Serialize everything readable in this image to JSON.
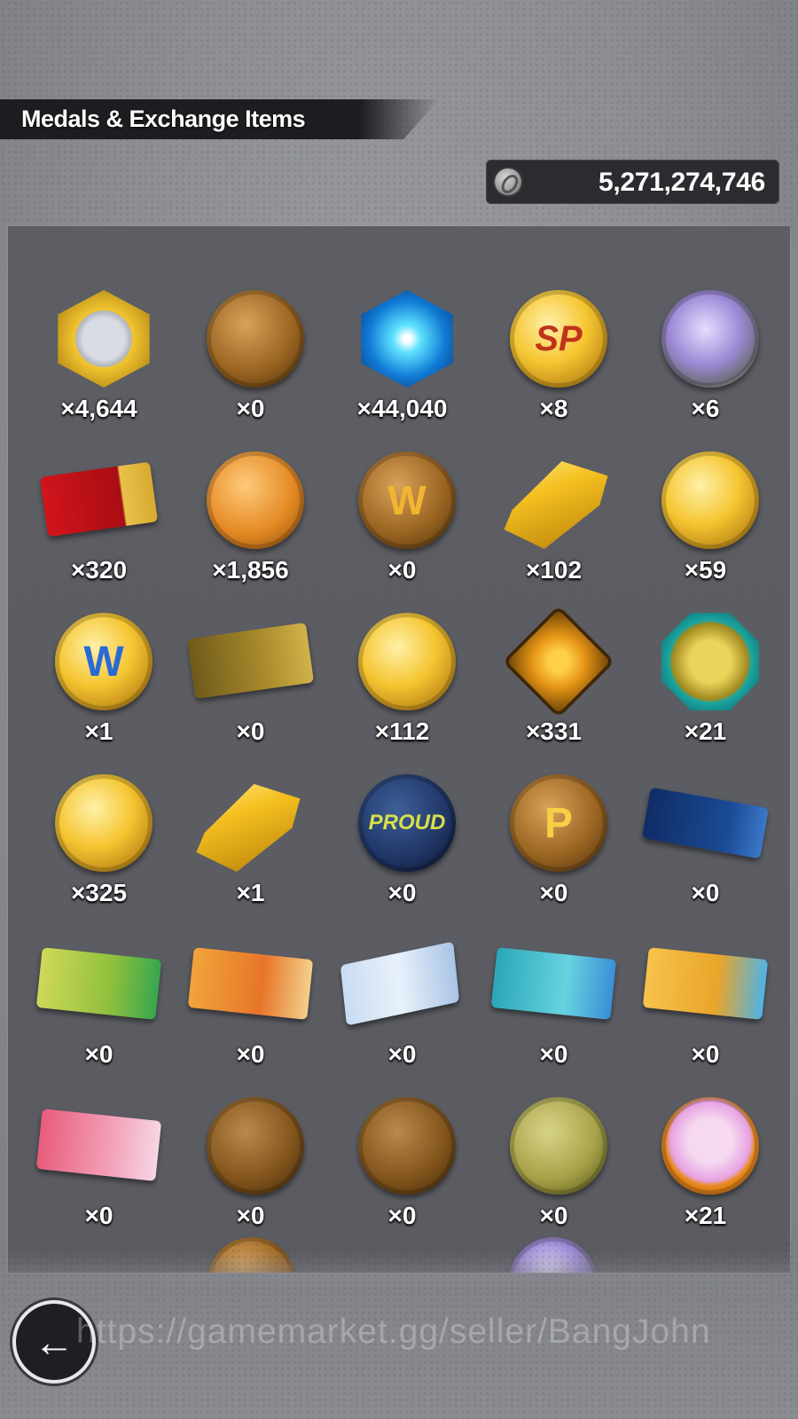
{
  "header": {
    "title": "Medals & Exchange Items"
  },
  "currency": {
    "icon": "zeni-coin-icon",
    "value": "5,271,274,746"
  },
  "items": [
    {
      "name": "fist-hex-medal",
      "count": "×4,644"
    },
    {
      "name": "flame-bronze-medal",
      "count": "×0"
    },
    {
      "name": "blue-burst-hex-medal",
      "count": "×44,040"
    },
    {
      "name": "sp-gold-medal",
      "count": "×8"
    },
    {
      "name": "silver-crystal-medal",
      "count": "×6"
    },
    {
      "name": "red-star-ticket",
      "count": "×320"
    },
    {
      "name": "orange-card-coin",
      "count": "×1,856"
    },
    {
      "name": "w-bronze-medal",
      "count": "×0"
    },
    {
      "name": "gold-bars",
      "count": "×102"
    },
    {
      "name": "burst-gold-medal",
      "count": "×59"
    },
    {
      "name": "w-gold-medal",
      "count": "×1"
    },
    {
      "name": "pass-ticket",
      "count": "×0"
    },
    {
      "name": "puzzle-gold-medal",
      "count": "×112"
    },
    {
      "name": "flame-diamond-medal",
      "count": "×331"
    },
    {
      "name": "trophy-octagon-medal",
      "count": "×21"
    },
    {
      "name": "crystal-gold-medal",
      "count": "×325"
    },
    {
      "name": "sparkling-gold-bars",
      "count": "×1"
    },
    {
      "name": "proud-blue-medal",
      "count": "×0"
    },
    {
      "name": "p-gold-medal",
      "count": "×0"
    },
    {
      "name": "blue-ticket",
      "count": "×0"
    },
    {
      "name": "green-summon-ticket",
      "count": "×0"
    },
    {
      "name": "sp-summon-ticket",
      "count": "×0"
    },
    {
      "name": "white-ticket",
      "count": "×0"
    },
    {
      "name": "teal-summon-ticket",
      "count": "×0"
    },
    {
      "name": "amber-summon-ticket",
      "count": "×0"
    },
    {
      "name": "pink-summon-ticket",
      "count": "×0"
    },
    {
      "name": "bandage-bronze-medal",
      "count": "×0"
    },
    {
      "name": "gi-bronze-medal",
      "count": "×0"
    },
    {
      "name": "olive-medal",
      "count": "×0"
    },
    {
      "name": "character-portrait-medal",
      "count": "×21"
    }
  ],
  "glyphs": {
    "sp": "SP",
    "w": "W",
    "proud": "PROUD",
    "p": "P"
  },
  "nav": {
    "back_label": "←"
  },
  "watermark": "https://gamemarket.gg/seller/BangJohn"
}
